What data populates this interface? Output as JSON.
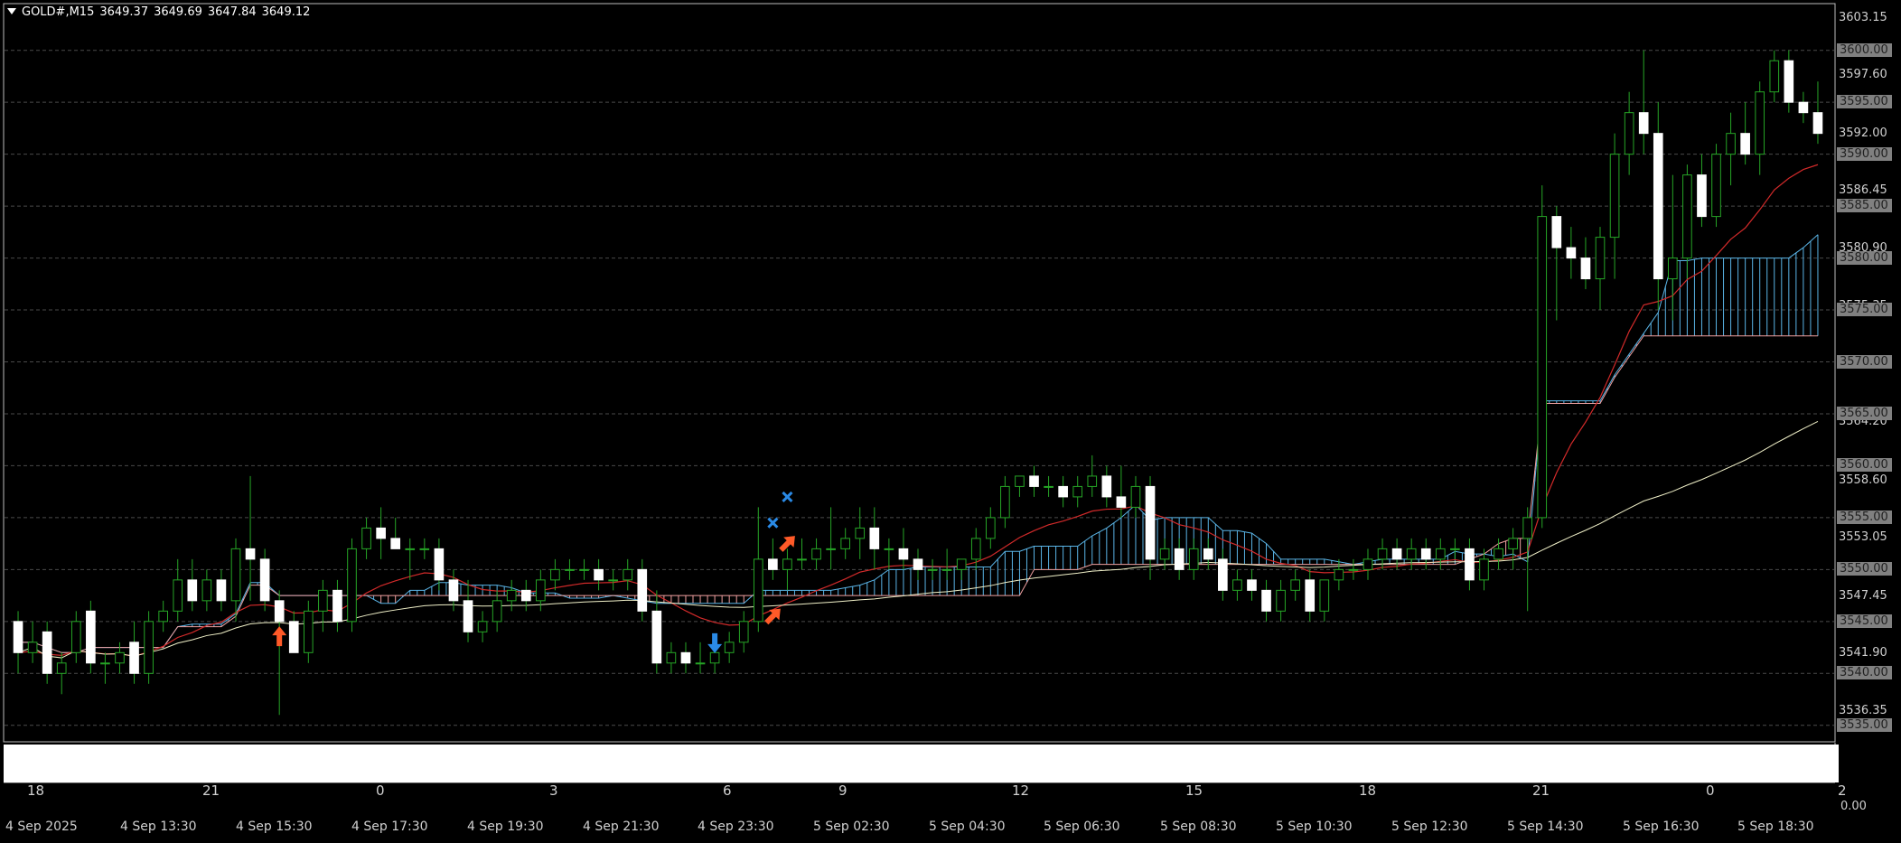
{
  "header": {
    "symbol": "GOLD#,M15",
    "open": "3649.37",
    "high": "3649.69",
    "low": "3647.84",
    "close": "3649.12"
  },
  "colors": {
    "background": "#000000",
    "grid": "#4a4a4a",
    "bull_candle": "#26a526",
    "bear_candle": "#ffffff",
    "cloud_bull": "#5ab4e6",
    "cloud_bear": "#f0a0a0",
    "ma_fast": "#d22a2a",
    "ma_slow": "#f0f0c8",
    "arrow_up": "#ff5a28",
    "arrow_down": "#2a8ae6",
    "cross": "#2a8ae6"
  },
  "price_axis": {
    "grid_labels": [
      "3600.00",
      "3595.00",
      "3590.00",
      "3585.00",
      "3580.00",
      "3575.00",
      "3570.00",
      "3565.00",
      "3560.00",
      "3555.00",
      "3550.00",
      "3545.00",
      "3540.00",
      "3535.00"
    ],
    "scale_labels": [
      "3603.15",
      "3597.60",
      "3592.00",
      "3586.45",
      "3580.90",
      "3575.35",
      "3569.75",
      "3564.20",
      "3558.60",
      "3553.05",
      "3547.45",
      "3541.90",
      "3536.35"
    ]
  },
  "time_axis": {
    "top_labels": [
      "18",
      "21",
      "0",
      "3",
      "6",
      "9",
      "12",
      "15",
      "18",
      "21",
      "0",
      "2"
    ],
    "bottom_labels": [
      "4 Sep 2025",
      "4 Sep 13:30",
      "4 Sep 15:30",
      "4 Sep 17:30",
      "4 Sep 19:30",
      "4 Sep 21:30",
      "4 Sep 23:30",
      "5 Sep 02:30",
      "5 Sep 04:30",
      "5 Sep 06:30",
      "5 Sep 08:30",
      "5 Sep 10:30",
      "5 Sep 12:30",
      "5 Sep 14:30",
      "5 Sep 16:30",
      "5 Sep 18:30"
    ],
    "corner": "0.00"
  },
  "chart_data": {
    "type": "candlestick",
    "y_range": [
      3533.5,
      3604.5
    ],
    "candles": [
      {
        "o": 3545,
        "h": 3546,
        "l": 3540,
        "c": 3542
      },
      {
        "o": 3542,
        "h": 3545,
        "l": 3541,
        "c": 3543
      },
      {
        "o": 3544,
        "h": 3545,
        "l": 3539,
        "c": 3540
      },
      {
        "o": 3540,
        "h": 3542,
        "l": 3538,
        "c": 3541
      },
      {
        "o": 3542,
        "h": 3546,
        "l": 3541,
        "c": 3545
      },
      {
        "o": 3546,
        "h": 3547,
        "l": 3540,
        "c": 3541
      },
      {
        "o": 3541,
        "h": 3542,
        "l": 3539,
        "c": 3541
      },
      {
        "o": 3541,
        "h": 3543,
        "l": 3540,
        "c": 3542
      },
      {
        "o": 3543,
        "h": 3545,
        "l": 3539,
        "c": 3540
      },
      {
        "o": 3540,
        "h": 3546,
        "l": 3539,
        "c": 3545
      },
      {
        "o": 3545,
        "h": 3547,
        "l": 3544,
        "c": 3546
      },
      {
        "o": 3546,
        "h": 3551,
        "l": 3545,
        "c": 3549
      },
      {
        "o": 3549,
        "h": 3551,
        "l": 3546,
        "c": 3547
      },
      {
        "o": 3547,
        "h": 3550,
        "l": 3546,
        "c": 3549
      },
      {
        "o": 3549,
        "h": 3550,
        "l": 3546,
        "c": 3547
      },
      {
        "o": 3547,
        "h": 3553,
        "l": 3545,
        "c": 3552
      },
      {
        "o": 3552,
        "h": 3559,
        "l": 3547,
        "c": 3551
      },
      {
        "o": 3551,
        "h": 3552,
        "l": 3546,
        "c": 3547
      },
      {
        "o": 3547,
        "h": 3548,
        "l": 3536,
        "c": 3545
      },
      {
        "o": 3545,
        "h": 3546,
        "l": 3542,
        "c": 3542
      },
      {
        "o": 3542,
        "h": 3547,
        "l": 3541,
        "c": 3546
      },
      {
        "o": 3546,
        "h": 3549,
        "l": 3544,
        "c": 3548
      },
      {
        "o": 3548,
        "h": 3549,
        "l": 3544,
        "c": 3545
      },
      {
        "o": 3545,
        "h": 3553,
        "l": 3544,
        "c": 3552
      },
      {
        "o": 3552,
        "h": 3555,
        "l": 3551,
        "c": 3554
      },
      {
        "o": 3554,
        "h": 3556,
        "l": 3551,
        "c": 3553
      },
      {
        "o": 3553,
        "h": 3555,
        "l": 3552,
        "c": 3552
      },
      {
        "o": 3552,
        "h": 3553,
        "l": 3549,
        "c": 3552
      },
      {
        "o": 3552,
        "h": 3553,
        "l": 3551,
        "c": 3552
      },
      {
        "o": 3552,
        "h": 3553,
        "l": 3548,
        "c": 3549
      },
      {
        "o": 3549,
        "h": 3550,
        "l": 3546,
        "c": 3547
      },
      {
        "o": 3547,
        "h": 3549,
        "l": 3543,
        "c": 3544
      },
      {
        "o": 3544,
        "h": 3546,
        "l": 3543,
        "c": 3545
      },
      {
        "o": 3545,
        "h": 3548,
        "l": 3544,
        "c": 3547
      },
      {
        "o": 3547,
        "h": 3549,
        "l": 3546,
        "c": 3548
      },
      {
        "o": 3548,
        "h": 3549,
        "l": 3546,
        "c": 3547
      },
      {
        "o": 3547,
        "h": 3550,
        "l": 3546,
        "c": 3549
      },
      {
        "o": 3549,
        "h": 3551,
        "l": 3548,
        "c": 3550
      },
      {
        "o": 3550,
        "h": 3551,
        "l": 3549,
        "c": 3550
      },
      {
        "o": 3550,
        "h": 3551,
        "l": 3549,
        "c": 3550
      },
      {
        "o": 3550,
        "h": 3551,
        "l": 3548,
        "c": 3549
      },
      {
        "o": 3549,
        "h": 3550,
        "l": 3548,
        "c": 3549
      },
      {
        "o": 3549,
        "h": 3551,
        "l": 3548,
        "c": 3550
      },
      {
        "o": 3550,
        "h": 3551,
        "l": 3545,
        "c": 3546
      },
      {
        "o": 3546,
        "h": 3548,
        "l": 3540,
        "c": 3541
      },
      {
        "o": 3541,
        "h": 3543,
        "l": 3540,
        "c": 3542
      },
      {
        "o": 3542,
        "h": 3543,
        "l": 3540,
        "c": 3541
      },
      {
        "o": 3541,
        "h": 3543,
        "l": 3540,
        "c": 3541
      },
      {
        "o": 3541,
        "h": 3543,
        "l": 3540,
        "c": 3542
      },
      {
        "o": 3542,
        "h": 3544,
        "l": 3541,
        "c": 3543
      },
      {
        "o": 3543,
        "h": 3546,
        "l": 3542,
        "c": 3545
      },
      {
        "o": 3545,
        "h": 3556,
        "l": 3544,
        "c": 3551
      },
      {
        "o": 3551,
        "h": 3553,
        "l": 3549,
        "c": 3550
      },
      {
        "o": 3550,
        "h": 3552,
        "l": 3548,
        "c": 3551
      },
      {
        "o": 3551,
        "h": 3553,
        "l": 3550,
        "c": 3551
      },
      {
        "o": 3551,
        "h": 3553,
        "l": 3550,
        "c": 3552
      },
      {
        "o": 3552,
        "h": 3556,
        "l": 3550,
        "c": 3552
      },
      {
        "o": 3552,
        "h": 3554,
        "l": 3551,
        "c": 3553
      },
      {
        "o": 3553,
        "h": 3556,
        "l": 3551,
        "c": 3554
      },
      {
        "o": 3554,
        "h": 3556,
        "l": 3550,
        "c": 3552
      },
      {
        "o": 3552,
        "h": 3553,
        "l": 3550,
        "c": 3552
      },
      {
        "o": 3552,
        "h": 3554,
        "l": 3550,
        "c": 3551
      },
      {
        "o": 3551,
        "h": 3552,
        "l": 3549,
        "c": 3550
      },
      {
        "o": 3550,
        "h": 3551,
        "l": 3549,
        "c": 3550
      },
      {
        "o": 3550,
        "h": 3552,
        "l": 3549,
        "c": 3550
      },
      {
        "o": 3550,
        "h": 3551,
        "l": 3549,
        "c": 3551
      },
      {
        "o": 3551,
        "h": 3554,
        "l": 3550,
        "c": 3553
      },
      {
        "o": 3553,
        "h": 3556,
        "l": 3552,
        "c": 3555
      },
      {
        "o": 3555,
        "h": 3559,
        "l": 3554,
        "c": 3558
      },
      {
        "o": 3558,
        "h": 3559,
        "l": 3557,
        "c": 3559
      },
      {
        "o": 3559,
        "h": 3560,
        "l": 3557,
        "c": 3558
      },
      {
        "o": 3558,
        "h": 3559,
        "l": 3557,
        "c": 3558
      },
      {
        "o": 3558,
        "h": 3559,
        "l": 3556,
        "c": 3557
      },
      {
        "o": 3557,
        "h": 3559,
        "l": 3556,
        "c": 3558
      },
      {
        "o": 3558,
        "h": 3561,
        "l": 3557,
        "c": 3559
      },
      {
        "o": 3559,
        "h": 3560,
        "l": 3556,
        "c": 3557
      },
      {
        "o": 3557,
        "h": 3560,
        "l": 3555,
        "c": 3556
      },
      {
        "o": 3556,
        "h": 3559,
        "l": 3555,
        "c": 3558
      },
      {
        "o": 3558,
        "h": 3559,
        "l": 3549,
        "c": 3551
      },
      {
        "o": 3551,
        "h": 3553,
        "l": 3550,
        "c": 3552
      },
      {
        "o": 3552,
        "h": 3553,
        "l": 3549,
        "c": 3550
      },
      {
        "o": 3550,
        "h": 3553,
        "l": 3549,
        "c": 3552
      },
      {
        "o": 3552,
        "h": 3553,
        "l": 3550,
        "c": 3551
      },
      {
        "o": 3551,
        "h": 3552,
        "l": 3547,
        "c": 3548
      },
      {
        "o": 3548,
        "h": 3550,
        "l": 3547,
        "c": 3549
      },
      {
        "o": 3549,
        "h": 3550,
        "l": 3547,
        "c": 3548
      },
      {
        "o": 3548,
        "h": 3549,
        "l": 3545,
        "c": 3546
      },
      {
        "o": 3546,
        "h": 3549,
        "l": 3545,
        "c": 3548
      },
      {
        "o": 3548,
        "h": 3550,
        "l": 3547,
        "c": 3549
      },
      {
        "o": 3549,
        "h": 3550,
        "l": 3545,
        "c": 3546
      },
      {
        "o": 3546,
        "h": 3549,
        "l": 3545,
        "c": 3549
      },
      {
        "o": 3549,
        "h": 3551,
        "l": 3548,
        "c": 3550
      },
      {
        "o": 3550,
        "h": 3551,
        "l": 3549,
        "c": 3550
      },
      {
        "o": 3550,
        "h": 3552,
        "l": 3549,
        "c": 3551
      },
      {
        "o": 3551,
        "h": 3553,
        "l": 3550,
        "c": 3552
      },
      {
        "o": 3552,
        "h": 3553,
        "l": 3550,
        "c": 3551
      },
      {
        "o": 3551,
        "h": 3553,
        "l": 3550,
        "c": 3552
      },
      {
        "o": 3552,
        "h": 3553,
        "l": 3550,
        "c": 3551
      },
      {
        "o": 3551,
        "h": 3553,
        "l": 3550,
        "c": 3552
      },
      {
        "o": 3552,
        "h": 3553,
        "l": 3551,
        "c": 3552
      },
      {
        "o": 3552,
        "h": 3553,
        "l": 3548,
        "c": 3549
      },
      {
        "o": 3549,
        "h": 3552,
        "l": 3548,
        "c": 3551
      },
      {
        "o": 3551,
        "h": 3553,
        "l": 3550,
        "c": 3552
      },
      {
        "o": 3552,
        "h": 3554,
        "l": 3550,
        "c": 3553
      },
      {
        "o": 3553,
        "h": 3556,
        "l": 3546,
        "c": 3555
      },
      {
        "o": 3555,
        "h": 3587,
        "l": 3554,
        "c": 3584
      },
      {
        "o": 3584,
        "h": 3585,
        "l": 3574,
        "c": 3581
      },
      {
        "o": 3581,
        "h": 3583,
        "l": 3578,
        "c": 3580
      },
      {
        "o": 3580,
        "h": 3582,
        "l": 3577,
        "c": 3578
      },
      {
        "o": 3578,
        "h": 3583,
        "l": 3575,
        "c": 3582
      },
      {
        "o": 3582,
        "h": 3592,
        "l": 3578,
        "c": 3590
      },
      {
        "o": 3590,
        "h": 3596,
        "l": 3588,
        "c": 3594
      },
      {
        "o": 3594,
        "h": 3600,
        "l": 3590,
        "c": 3592
      },
      {
        "o": 3592,
        "h": 3595,
        "l": 3575,
        "c": 3578
      },
      {
        "o": 3578,
        "h": 3588,
        "l": 3574,
        "c": 3580
      },
      {
        "o": 3580,
        "h": 3589,
        "l": 3578,
        "c": 3588
      },
      {
        "o": 3588,
        "h": 3590,
        "l": 3583,
        "c": 3584
      },
      {
        "o": 3584,
        "h": 3591,
        "l": 3583,
        "c": 3590
      },
      {
        "o": 3590,
        "h": 3594,
        "l": 3587,
        "c": 3592
      },
      {
        "o": 3592,
        "h": 3595,
        "l": 3589,
        "c": 3590
      },
      {
        "o": 3590,
        "h": 3597,
        "l": 3588,
        "c": 3596
      },
      {
        "o": 3596,
        "h": 3600,
        "l": 3595,
        "c": 3599
      },
      {
        "o": 3599,
        "h": 3600,
        "l": 3594,
        "c": 3595
      },
      {
        "o": 3595,
        "h": 3596,
        "l": 3593,
        "c": 3594
      },
      {
        "o": 3594,
        "h": 3597,
        "l": 3591,
        "c": 3592
      }
    ]
  }
}
